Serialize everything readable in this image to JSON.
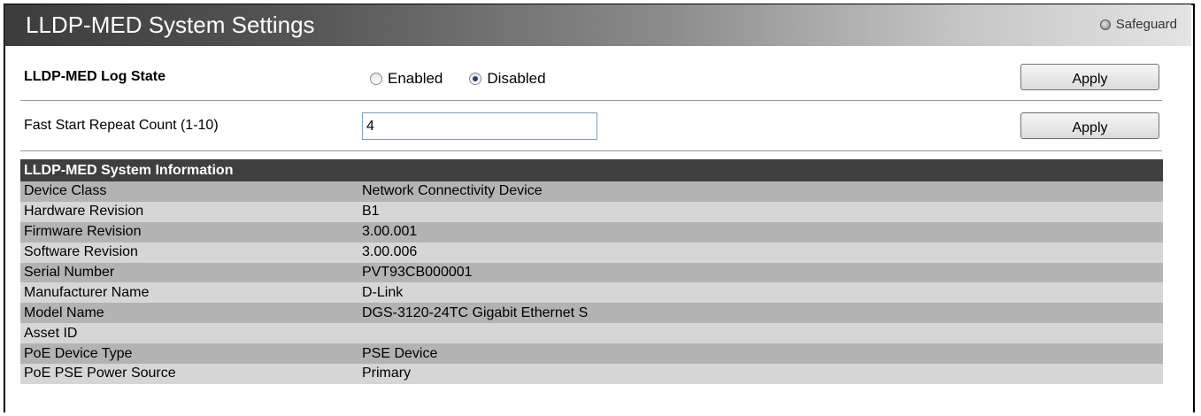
{
  "header": {
    "title": "LLDP-MED System Settings",
    "safeguard_label": "Safeguard"
  },
  "log_state": {
    "label": "LLDP-MED Log State",
    "options": [
      {
        "label": "Enabled",
        "checked": false
      },
      {
        "label": "Disabled",
        "checked": true
      }
    ],
    "apply_label": "Apply"
  },
  "fast_start": {
    "label": "Fast Start Repeat Count (1-10)",
    "value": "4",
    "apply_label": "Apply"
  },
  "system_info": {
    "header": "LLDP-MED System Information",
    "rows": [
      {
        "key": "Device Class",
        "value": "Network Connectivity Device"
      },
      {
        "key": "Hardware Revision",
        "value": "B1"
      },
      {
        "key": "Firmware Revision",
        "value": "3.00.001"
      },
      {
        "key": "Software Revision",
        "value": "3.00.006"
      },
      {
        "key": "Serial Number",
        "value": "PVT93CB000001"
      },
      {
        "key": "Manufacturer Name",
        "value": "D-Link"
      },
      {
        "key": "Model Name",
        "value": "DGS-3120-24TC Gigabit Ethernet S"
      },
      {
        "key": "Asset ID",
        "value": ""
      },
      {
        "key": "PoE Device Type",
        "value": "PSE Device"
      },
      {
        "key": "PoE PSE Power Source",
        "value": "Primary"
      }
    ]
  }
}
